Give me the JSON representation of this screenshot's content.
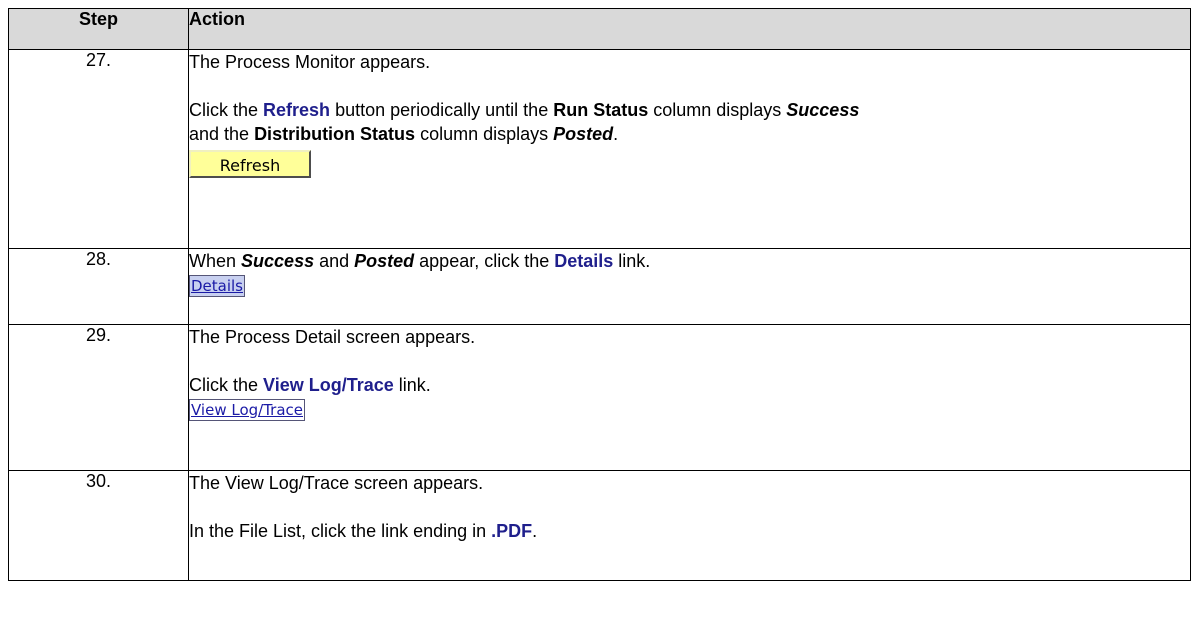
{
  "header": {
    "step": "Step",
    "action": "Action"
  },
  "rows": [
    {
      "num": "27.",
      "line1": "The Process Monitor appears.",
      "l2_a": "Click the ",
      "l2_refresh": "Refresh",
      "l2_b": " button periodically until the ",
      "l2_runstatus": "Run Status",
      "l2_c": " column displays ",
      "l2_success": "Success",
      "l3_a": "and the ",
      "l3_dist": "Distribution Status",
      "l3_b": " column displays ",
      "l3_posted": "Posted",
      "l3_c": ".",
      "button_label": "Refresh"
    },
    {
      "num": "28.",
      "a": "When ",
      "success": "Success",
      "b": " and ",
      "posted": "Posted",
      "c": " appear, click the ",
      "details": "Details",
      "d": " link.",
      "link_label": "Details"
    },
    {
      "num": "29.",
      "line1": "The Process Detail screen appears.",
      "a": "Click the ",
      "viewlog": "View Log/Trace",
      "b": " link.",
      "link_label": "View Log/Trace"
    },
    {
      "num": "30.",
      "line1": "The View Log/Trace screen appears.",
      "a": "In the File List, click the link ending in ",
      "pdf": ".PDF",
      "b": "."
    }
  ]
}
